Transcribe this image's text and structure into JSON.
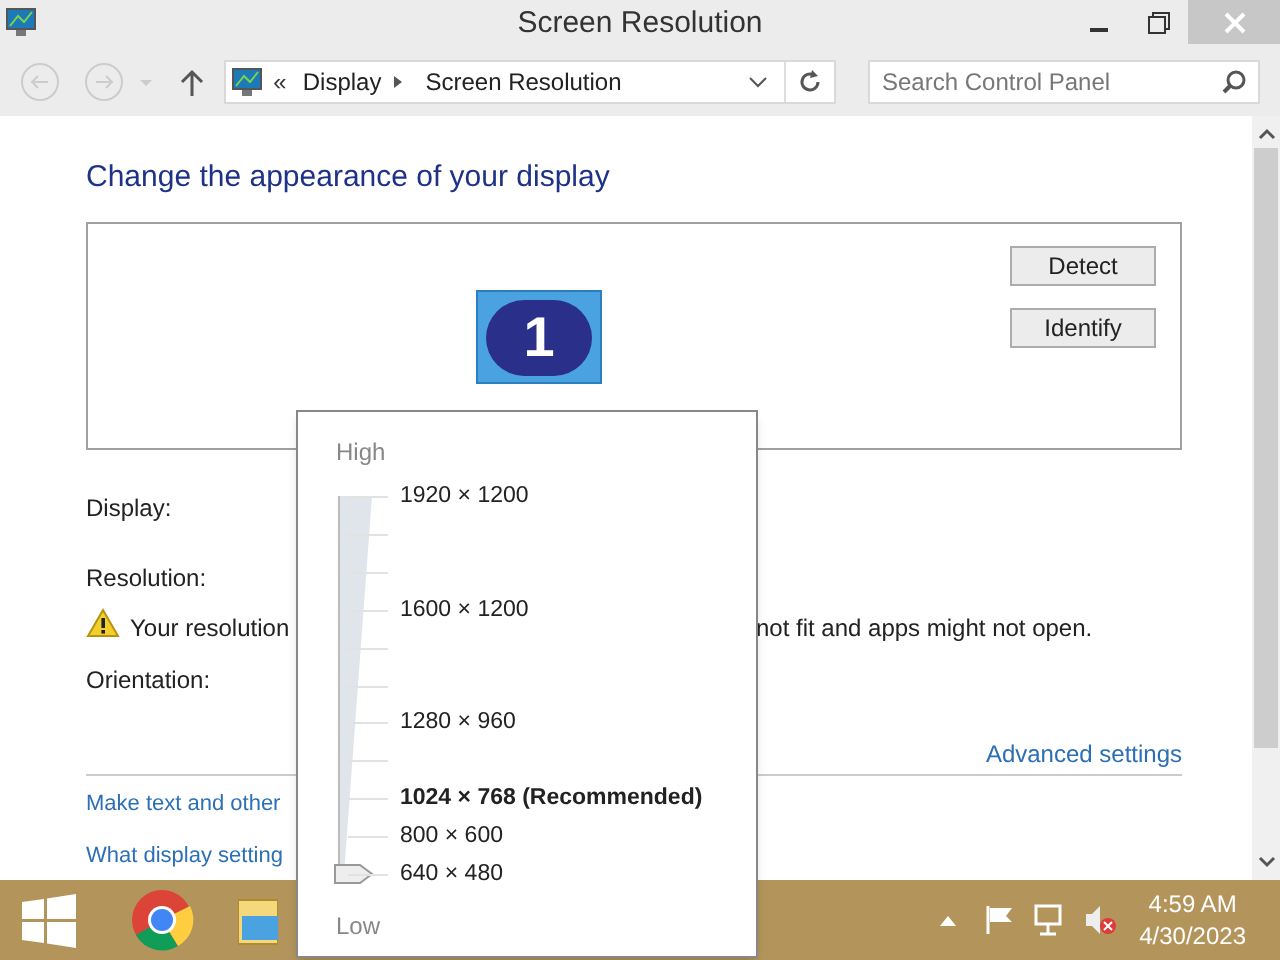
{
  "window": {
    "title": "Screen Resolution"
  },
  "address_bar": {
    "prefix": "«",
    "crumbs": [
      "Display",
      "Screen Resolution"
    ]
  },
  "search": {
    "placeholder": "Search Control Panel"
  },
  "heading": "Change the appearance of your display",
  "buttons": [
    "Detect",
    "Identify"
  ],
  "monitor": {
    "number": "1"
  },
  "fields": [
    {
      "label": "Display:"
    },
    {
      "label": "Resolution:"
    }
  ],
  "warning": {
    "text_start": "Your resolution",
    "text_end": "not fit and apps might not open."
  },
  "orientation": {
    "label": "Orientation:"
  },
  "advanced_link": "Advanced settings",
  "links": [
    "Make text and other",
    "What display setting"
  ],
  "resolution_popup": {
    "high_label": "High",
    "low_label": "Low",
    "level": 0,
    "options": [
      {
        "label": "1920 × 1200",
        "recommended": false
      },
      {
        "label": "1600 × 1200",
        "recommended": false
      },
      {
        "label": "1280 × 960",
        "recommended": false
      },
      {
        "label": "1024 × 768 (Recommended)",
        "recommended": true
      },
      {
        "label": "800 × 600",
        "recommended": false
      },
      {
        "label": "640 × 480",
        "recommended": false
      }
    ]
  },
  "taskbar": {
    "time": "4:59 AM",
    "date": "4/30/2023"
  }
}
